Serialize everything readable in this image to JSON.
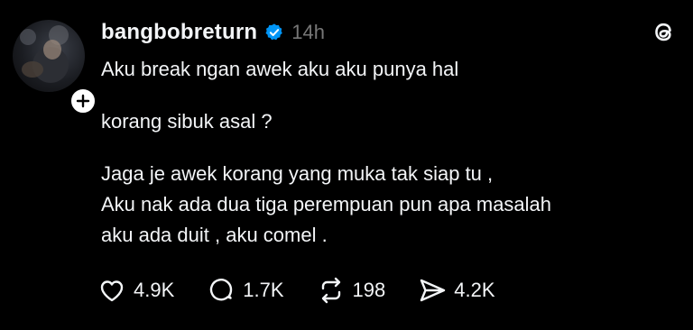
{
  "post": {
    "username": "bangbobreturn",
    "time": "14h",
    "paragraphs": [
      "Aku break ngan awek aku aku punya hal",
      "korang sibuk asal ?",
      "Jaga je awek korang yang muka tak siap tu ,\nAku nak ada dua tiga perempuan pun apa masalah\naku ada duit , aku comel ."
    ]
  },
  "actions": {
    "likes": "4.9K",
    "replies": "1.7K",
    "reposts": "198",
    "shares": "4.2K"
  },
  "icons": {
    "verified": "verified-badge-icon",
    "threads": "threads-logo-icon",
    "like": "heart-icon",
    "reply": "speech-bubble-icon",
    "repost": "repost-icon",
    "share": "paper-plane-icon",
    "follow": "plus-icon"
  },
  "colors": {
    "background": "#000000",
    "text": "#f3f5f7",
    "muted": "#777777",
    "verified": "#0095f6"
  }
}
